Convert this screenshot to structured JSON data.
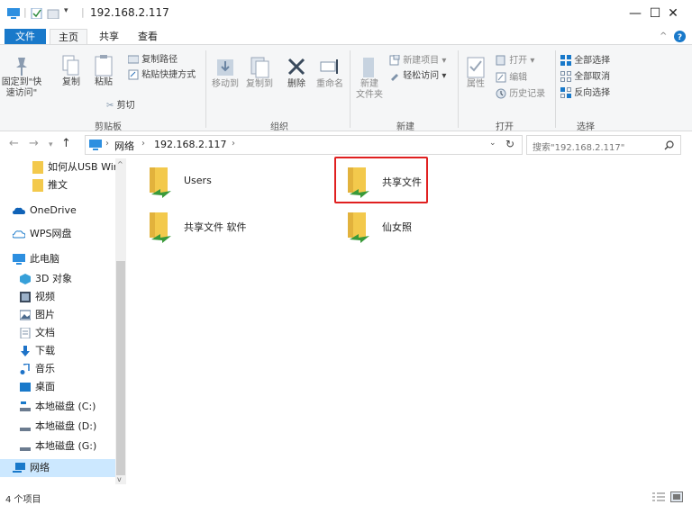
{
  "window": {
    "path_title": "192.168.2.117",
    "minimize": "—",
    "maximize": "☐",
    "close": "✕"
  },
  "tabs": {
    "file": "文件",
    "home": "主页",
    "share": "共享",
    "view": "查看",
    "help_icon": "help-icon"
  },
  "ribbon": {
    "pin": "固定到\"快",
    "pin2": "速访问\"",
    "copy": "复制",
    "paste": "粘贴",
    "copy_path": "复制路径",
    "paste_shortcut": "粘贴快捷方式",
    "cut": "剪切",
    "clipboard_group": "剪贴板",
    "move_to": "移动到",
    "copy_to": "复制到",
    "delete": "删除",
    "rename": "重命名",
    "organize_group": "组织",
    "new_folder": "新建",
    "new_folder2": "文件夹",
    "new_item": "新建项目",
    "easy_access": "轻松访问",
    "new_group": "新建",
    "properties": "属性",
    "open": "打开",
    "edit": "编辑",
    "history": "历史记录",
    "open_group": "打开",
    "select_all": "全部选择",
    "select_none": "全部取消",
    "invert_selection": "反向选择",
    "select_group": "选择"
  },
  "address": {
    "crumb_network": "网络",
    "crumb_host": "192.168.2.117",
    "search_placeholder": "搜索\"192.168.2.117\""
  },
  "nav": [
    {
      "label": "如何从USB Win",
      "icon": "folder-icon"
    },
    {
      "label": "推文",
      "icon": "folder-icon"
    },
    {
      "label": "OneDrive",
      "icon": "onedrive-cloud-icon"
    },
    {
      "label": "WPS网盘",
      "icon": "wps-cloud-icon"
    },
    {
      "label": "此电脑",
      "icon": "computer-icon"
    },
    {
      "label": "3D 对象",
      "icon": "3d-objects-icon"
    },
    {
      "label": "视频",
      "icon": "video-icon"
    },
    {
      "label": "图片",
      "icon": "pictures-icon"
    },
    {
      "label": "文档",
      "icon": "documents-icon"
    },
    {
      "label": "下载",
      "icon": "download-icon"
    },
    {
      "label": "音乐",
      "icon": "music-icon"
    },
    {
      "label": "桌面",
      "icon": "desktop-icon"
    },
    {
      "label": "本地磁盘 (C:)",
      "icon": "system-drive-icon"
    },
    {
      "label": "本地磁盘 (D:)",
      "icon": "drive-icon"
    },
    {
      "label": "本地磁盘 (G:)",
      "icon": "drive-icon"
    },
    {
      "label": "网络",
      "icon": "network-icon"
    }
  ],
  "items": [
    {
      "label": "Users",
      "icon": "shared-folder-icon"
    },
    {
      "label": "共享文件",
      "icon": "shared-folder-icon"
    },
    {
      "label": "共享文件 软件",
      "icon": "shared-folder-icon"
    },
    {
      "label": "仙女照",
      "icon": "shared-folder-icon"
    }
  ],
  "status": {
    "count": "4 个项目"
  },
  "colors": {
    "accent": "#1979ca",
    "highlight_border": "#e02020",
    "folder": "#f3c94c"
  }
}
